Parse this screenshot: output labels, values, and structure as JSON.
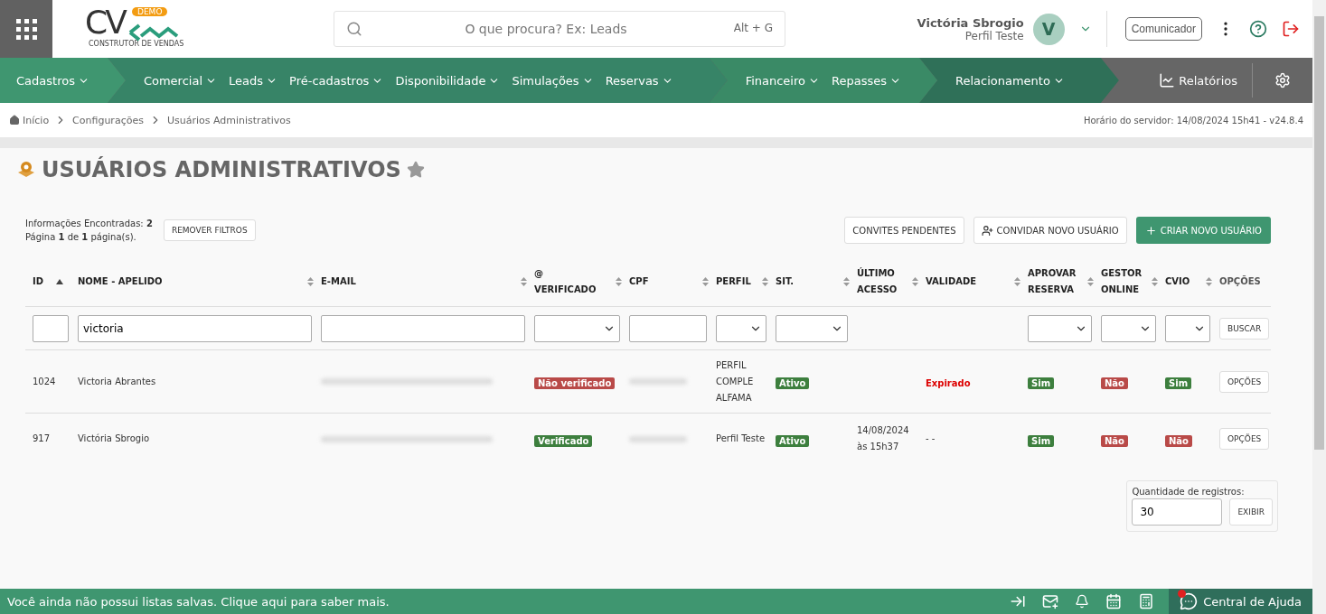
{
  "header": {
    "logo": {
      "letters": "CV",
      "badge": "DEMO",
      "tagline": "CONSTRUTOR DE VENDAS"
    },
    "search": {
      "placeholder": "O que procura? Ex: Leads",
      "shortcut": "Alt + G"
    },
    "user": {
      "name": "Victória Sbrogio",
      "profile": "Perfil Teste",
      "initial": "V"
    },
    "communicator": "Comunicador"
  },
  "nav": {
    "groups": [
      {
        "color": "#3f9670",
        "items": [
          "Cadastros"
        ]
      },
      {
        "color": "#378467",
        "items": [
          "Comercial",
          "Leads",
          "Pré-cadastros",
          "Disponibilidade",
          "Simulações",
          "Reservas"
        ]
      },
      {
        "color": "#3a8a66",
        "items": [
          "Financeiro",
          "Repasses"
        ]
      },
      {
        "color": "#2f7058",
        "items": [
          "Relacionamento"
        ]
      }
    ],
    "reports": "Relatórios"
  },
  "breadcrumb": [
    "Início",
    "Configurações",
    "Usuários Administrativos"
  ],
  "server_info": "Horário do servidor: 14/08/2024 15h41 - v24.8.4",
  "page_title": "USUÁRIOS ADMINISTRATIVOS",
  "summary": {
    "found": "Informações Encontradas: **2**",
    "page": "Página **1** de **1** página(s)."
  },
  "remove_filters": "REMOVER FILTROS",
  "actions": {
    "pending": "CONVITES PENDENTES",
    "invite": "CONVIDAR NOVO USUÁRIO",
    "create": "CRIAR NOVO USUÁRIO"
  },
  "table": {
    "columns": [
      {
        "label": "ID",
        "sortable": true,
        "sorted": true,
        "filter": {
          "kind": "text"
        }
      },
      {
        "label": "NOME - APELIDO",
        "sortable": true,
        "sorted": false,
        "filter": {
          "kind": "text",
          "value": "victoria"
        }
      },
      {
        "label": "E-MAIL",
        "sortable": true,
        "sorted": false,
        "filter": {
          "kind": "text"
        }
      },
      {
        "label": "@ VERIFICADO",
        "sortable": true,
        "sorted": false,
        "filter": {
          "kind": "select"
        }
      },
      {
        "label": "CPF",
        "sortable": true,
        "sorted": false,
        "filter": {
          "kind": "text"
        }
      },
      {
        "label": "PERFIL",
        "sortable": true,
        "sorted": false,
        "filter": {
          "kind": "select"
        }
      },
      {
        "label": "SIT.",
        "sortable": true,
        "sorted": false,
        "filter": {
          "kind": "select"
        }
      },
      {
        "label": "ÚLTIMO ACESSO",
        "sortable": true,
        "sorted": false,
        "filter": {
          "kind": "none"
        }
      },
      {
        "label": "VALIDADE",
        "sortable": true,
        "sorted": false,
        "filter": {
          "kind": "none"
        }
      },
      {
        "label": "APROVAR RESERVA",
        "sortable": true,
        "sorted": false,
        "filter": {
          "kind": "select"
        }
      },
      {
        "label": "GESTOR ONLINE",
        "sortable": true,
        "sorted": false,
        "filter": {
          "kind": "select"
        }
      },
      {
        "label": "CVIO",
        "sortable": true,
        "sorted": false,
        "filter": {
          "kind": "select"
        }
      },
      {
        "label": "OPÇÕES",
        "sortable": false,
        "filter": {
          "kind": "button",
          "label": "BUSCAR"
        }
      }
    ],
    "rows": [
      {
        "cells": [
          {
            "kind": "text",
            "text": "1024"
          },
          {
            "kind": "text",
            "text": "Victoria Abrantes"
          },
          {
            "kind": "redacted"
          },
          {
            "kind": "badge",
            "text": "Não verificado",
            "color": "#b94a48"
          },
          {
            "kind": "redacted"
          },
          {
            "kind": "text",
            "text": "PERFIL COMPLE ALFAMA"
          },
          {
            "kind": "badge",
            "text": "Ativo",
            "color": "#3d7f3e"
          },
          {
            "kind": "empty"
          },
          {
            "kind": "alert",
            "text": "Expirado"
          },
          {
            "kind": "badge",
            "text": "Sim",
            "color": "#3d7f3e"
          },
          {
            "kind": "badge",
            "text": "Não",
            "color": "#b94a48"
          },
          {
            "kind": "badge",
            "text": "Sim",
            "color": "#3d7f3e"
          },
          {
            "kind": "button",
            "text": "OPÇÕES"
          }
        ]
      },
      {
        "cells": [
          {
            "kind": "text",
            "text": "917"
          },
          {
            "kind": "text",
            "text": "Victória Sbrogio"
          },
          {
            "kind": "redacted"
          },
          {
            "kind": "badge",
            "text": "Verificado",
            "color": "#3d7f3e"
          },
          {
            "kind": "redacted"
          },
          {
            "kind": "text",
            "text": "Perfil Teste"
          },
          {
            "kind": "badge",
            "text": "Ativo",
            "color": "#3d7f3e"
          },
          {
            "kind": "text",
            "text": "14/08/2024 às 15h37"
          },
          {
            "kind": "text",
            "text": "- -"
          },
          {
            "kind": "badge",
            "text": "Sim",
            "color": "#3d7f3e"
          },
          {
            "kind": "badge",
            "text": "Não",
            "color": "#b94a48"
          },
          {
            "kind": "badge",
            "text": "Não",
            "color": "#b94a48"
          },
          {
            "kind": "button",
            "text": "OPÇÕES"
          }
        ]
      }
    ]
  },
  "records": {
    "label": "Quantidade de registros:",
    "value": "30",
    "button": "EXIBIR"
  },
  "footer": {
    "message": "Você ainda não possui listas salvas. Clique aqui para saber mais.",
    "help": "Central de Ajuda"
  }
}
